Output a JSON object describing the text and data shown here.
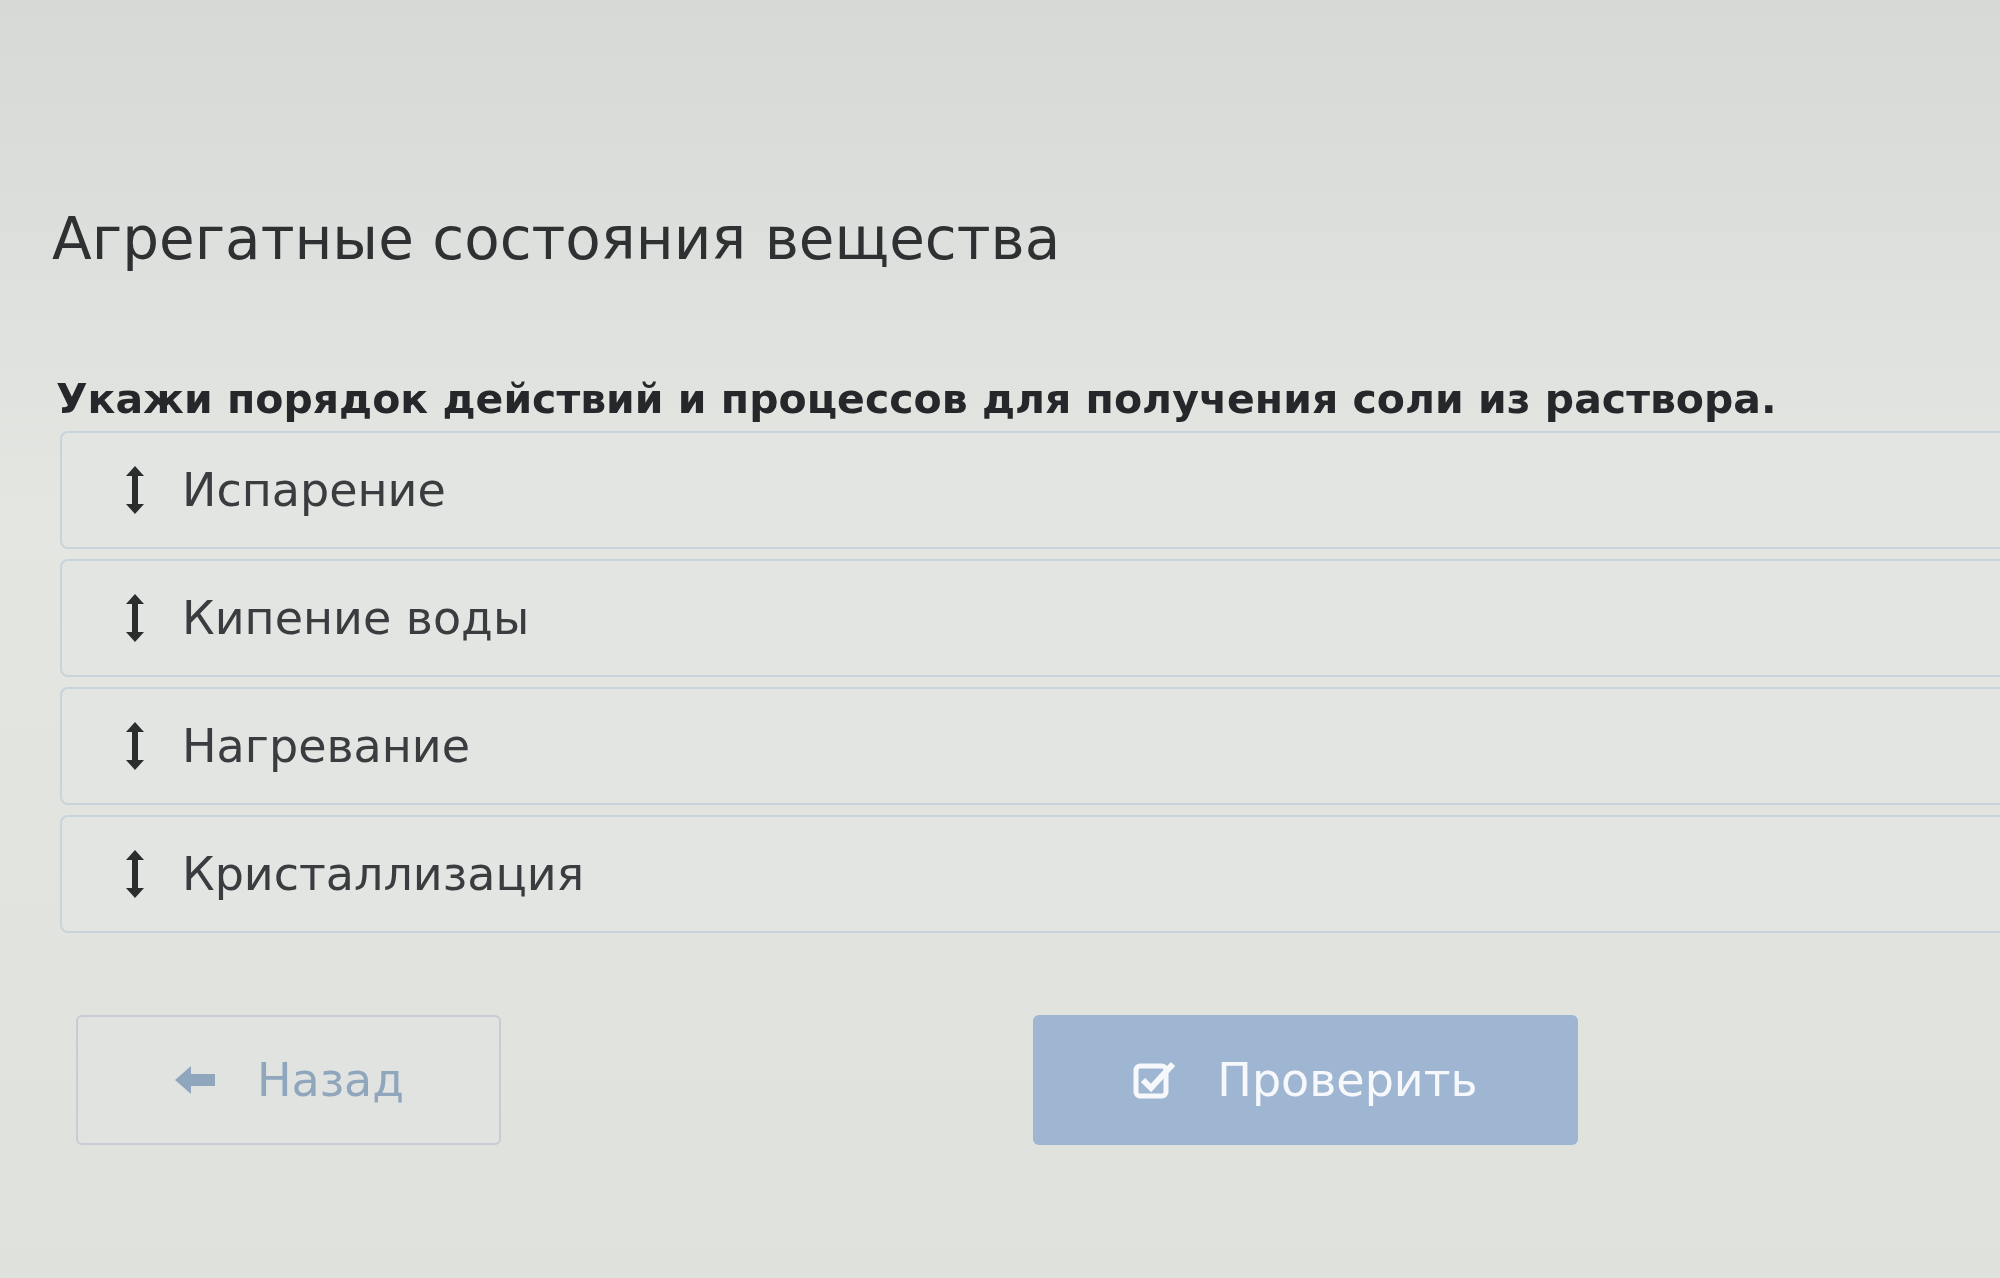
{
  "title": "Агрегатные состояния вещества",
  "question": "Укажи порядок действий и процессов для получения соли из раствора.",
  "items": [
    {
      "label": "Испарение"
    },
    {
      "label": "Кипение воды"
    },
    {
      "label": "Нагревание"
    },
    {
      "label": "Кристаллизация"
    }
  ],
  "buttons": [
    {
      "kind": "back",
      "label": "Назад",
      "disabled": true
    },
    {
      "kind": "check",
      "label": "Проверить",
      "disabled": true
    }
  ]
}
